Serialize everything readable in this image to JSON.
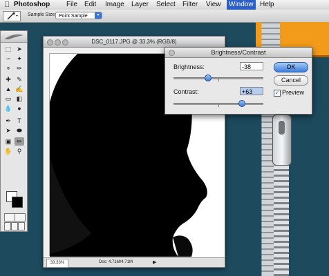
{
  "menubar": {
    "apple_glyph": "",
    "items": [
      "Photoshop",
      "File",
      "Edit",
      "Image",
      "Layer",
      "Select",
      "Filter",
      "View",
      "Window",
      "Help"
    ]
  },
  "options_bar": {
    "sample_size_label": "Sample Size:",
    "sample_size_value": "Point Sample"
  },
  "document": {
    "title": "DSC_0117.JPG @ 33.3% (RGB/8)",
    "zoom": "33.33%",
    "doc_info": "Doc: 4.71M/4.71M"
  },
  "dialog": {
    "title": "Brightness/Contrast",
    "brightness_label": "Brightness:",
    "brightness_value": "-38",
    "contrast_label": "Contrast:",
    "contrast_value": "+63",
    "ok_label": "OK",
    "cancel_label": "Cancel",
    "preview_label": "Preview",
    "preview_checked": true,
    "brightness_level": -38,
    "contrast_level": 63
  },
  "colors": {
    "desktop": "#1e4a5e",
    "zipper_accent": "#f29a1a",
    "selection_blue": "#3b79d8"
  },
  "icons": {
    "toolbox": [
      "marquee-icon",
      "move-icon",
      "lasso-icon",
      "magic-wand-icon",
      "crop-icon",
      "slice-icon",
      "healing-icon",
      "brush-icon",
      "stamp-icon",
      "history-brush-icon",
      "eraser-icon",
      "gradient-icon",
      "blur-icon",
      "dodge-icon",
      "pen-icon",
      "type-icon",
      "path-select-icon",
      "shape-icon",
      "notes-icon",
      "eyedropper-icon",
      "hand-icon",
      "zoom-icon"
    ]
  }
}
